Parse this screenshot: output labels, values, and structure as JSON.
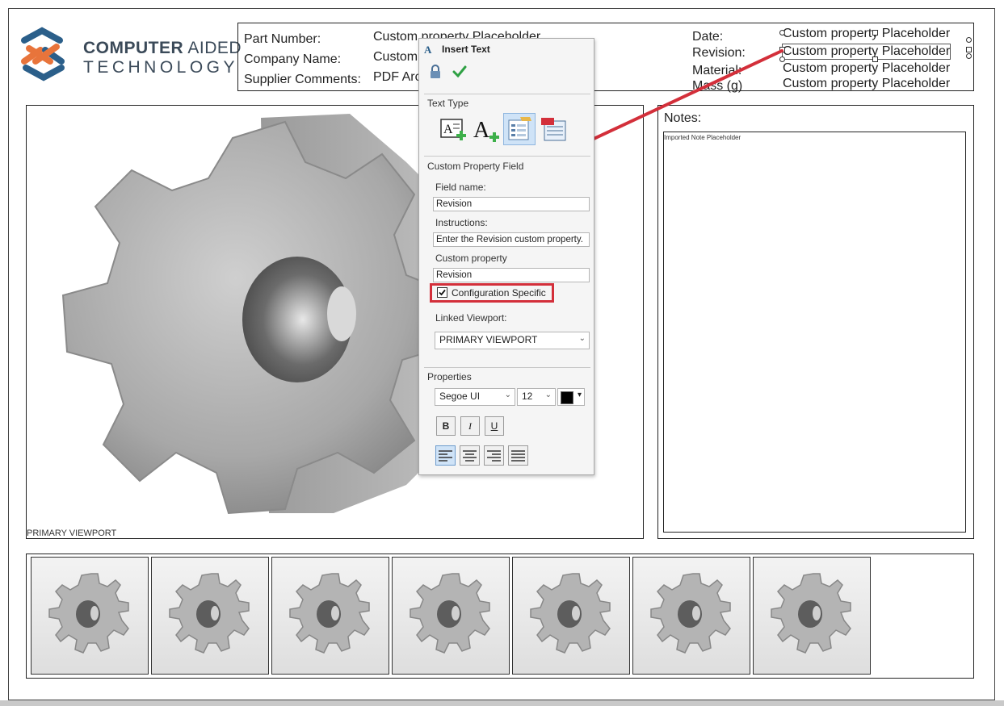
{
  "logo": {
    "line1_bold": "COMPUTER",
    "line1_rest": " AIDED",
    "line2": "TECHNOLOGY"
  },
  "title_block": {
    "left": [
      {
        "label": "Part Number:",
        "value": "Custom property Placeholder"
      },
      {
        "label": "Company Name:",
        "value": "Custom"
      },
      {
        "label": "Supplier Comments:",
        "value": "PDF Arc"
      }
    ],
    "right": [
      {
        "label": "Date:",
        "value": "Custom property Placeholder"
      },
      {
        "label": "Revision:",
        "value": "Custom property Placeholder"
      },
      {
        "label": "Material:",
        "value": "Custom property Placeholder"
      },
      {
        "label": "Mass (g)",
        "value": "Custom property Placeholder"
      }
    ]
  },
  "viewport": {
    "label": "PRIMARY VIEWPORT"
  },
  "notes": {
    "title": "Notes:",
    "placeholder": "Imported Note Placeholder"
  },
  "dialog": {
    "title": "Insert Text",
    "text_type_label": "Text Type",
    "custom_property_section": "Custom Property Field",
    "field_name_label": "Field name:",
    "field_name_value": "Revision",
    "instructions_label": "Instructions:",
    "instructions_value": "Enter the Revision custom property.",
    "custom_property_label": "Custom property",
    "custom_property_value": "Revision",
    "config_specific_label": "Configuration Specific",
    "config_specific_checked": true,
    "linked_viewport_label": "Linked Viewport:",
    "linked_viewport_value": "PRIMARY VIEWPORT",
    "properties_label": "Properties",
    "font_value": "Segoe UI",
    "size_value": "12",
    "bold_label": "B",
    "italic_label": "I",
    "underline_label": "U"
  },
  "thumbnails_count": 7,
  "colors": {
    "accent_red": "#d32f3a",
    "check_green": "#2ea043",
    "logo_orange": "#e8743b",
    "logo_blue": "#2b5f8a"
  }
}
